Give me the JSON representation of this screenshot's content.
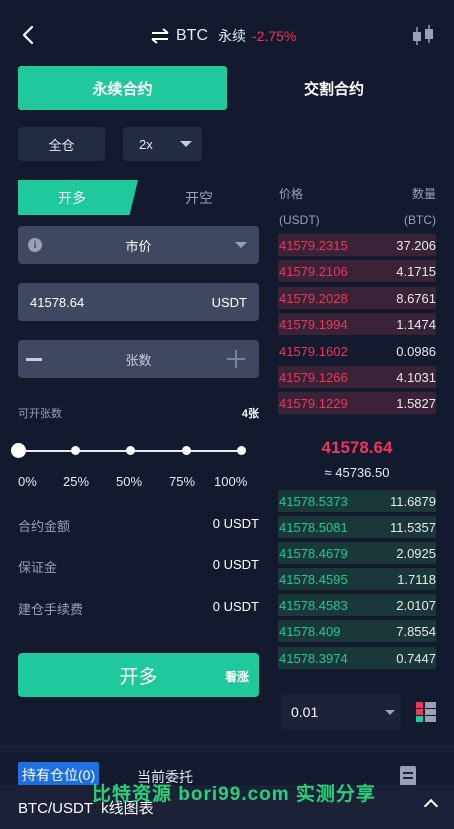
{
  "header": {
    "title_symbol": "BTC",
    "title_type": "永续",
    "change_pct": "-2.75%"
  },
  "tabs": {
    "perpetual": "永续合约",
    "delivery": "交割合约"
  },
  "margin_mode": "全仓",
  "leverage": "2x",
  "side_tabs": {
    "long": "开多",
    "short": "开空"
  },
  "order_form": {
    "order_type": "市价",
    "price_value": "41578.64",
    "price_unit": "USDT",
    "quantity_placeholder": "张数",
    "available_label": "可开张数",
    "available_value": "4张"
  },
  "slider": {
    "level": 0,
    "marks": [
      "0%",
      "25%",
      "50%",
      "75%",
      "100%"
    ]
  },
  "info": [
    {
      "label": "合约金额",
      "value": "0 USDT"
    },
    {
      "label": "保证金",
      "value": "0 USDT"
    },
    {
      "label": "建仓手续费",
      "value": "0 USDT"
    }
  ],
  "submit": {
    "label": "开多",
    "sub": "看涨"
  },
  "orderbook": {
    "price_label": "价格",
    "qty_label": "数量",
    "price_unit": "(USDT)",
    "qty_unit": "(BTC)",
    "asks": [
      {
        "p": "41579.2315",
        "v": "37.206"
      },
      {
        "p": "41579.2106",
        "v": "4.1715"
      },
      {
        "p": "41579.2028",
        "v": "8.6761"
      },
      {
        "p": "41579.1994",
        "v": "1.1474"
      },
      {
        "p": "41579.1602",
        "v": "0.0986"
      },
      {
        "p": "41579.1266",
        "v": "4.1031"
      },
      {
        "p": "41579.1229",
        "v": "1.5827"
      }
    ],
    "mid_price": "41578.64",
    "mid_fiat": "≈ 45736.50",
    "bids": [
      {
        "p": "41578.5373",
        "v": "11.6879"
      },
      {
        "p": "41578.5081",
        "v": "11.5357"
      },
      {
        "p": "41578.4679",
        "v": "2.0925"
      },
      {
        "p": "41578.4595",
        "v": "1.7118"
      },
      {
        "p": "41578.4583",
        "v": "2.0107"
      },
      {
        "p": "41578.409",
        "v": "7.8554"
      },
      {
        "p": "41578.3974",
        "v": "0.7447"
      }
    ],
    "step": "0.01"
  },
  "bottom_tabs": {
    "positions": "持有仓位(0)",
    "orders": "当前委托"
  },
  "bottom_bar": {
    "label": "BTC/USDT  k线图表"
  },
  "watermark": "比特资源  bori99.com  实测分享",
  "colors": {
    "accent": "#1fc99b",
    "down": "#f0355c",
    "bg": "#131a2e",
    "tab_blue": "#1f6fe0"
  }
}
